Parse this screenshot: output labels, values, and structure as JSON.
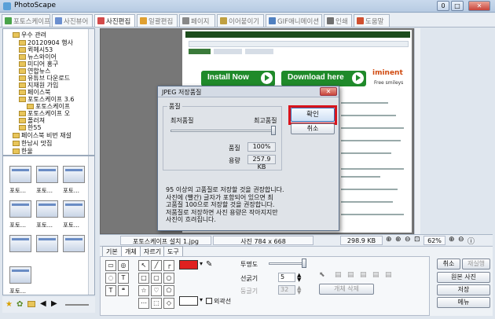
{
  "window": {
    "title": "PhotoScape"
  },
  "title_buttons": [
    "0",
    "□",
    "✕"
  ],
  "tabs": [
    {
      "label": "포토스케이프",
      "color": "#4aa44a"
    },
    {
      "label": "사진뷰어",
      "color": "#6b8fcf"
    },
    {
      "label": "사진편집",
      "color": "#d24a4a"
    },
    {
      "label": "일괄편집",
      "color": "#e0a030"
    },
    {
      "label": "페이지",
      "color": "#888888"
    },
    {
      "label": "이어붙이기",
      "color": "#c0a040"
    },
    {
      "label": "GIF애니메이션",
      "color": "#5080c0"
    },
    {
      "label": "인쇄",
      "color": "#707070"
    },
    {
      "label": "도움말",
      "color": "#d05030"
    }
  ],
  "tree": {
    "items": [
      "우수 관려",
      "20120904 행사",
      "퀵헤시53",
      "뉴스와이어",
      "미디어 홍구",
      "연합뉴스",
      "유튜브 다운로드",
      "지재원 가입",
      "페이스북",
      "포토스케이프 3.6",
      "포토스케이프",
      "포토스케이프 오",
      "폴러져",
      "한55",
      "페이스북 비번 재설",
      "한남시 맛집",
      "한울"
    ]
  },
  "thumbnails": {
    "captions": [
      "포토...",
      "포토...",
      "포토...",
      "포토...",
      "포토...",
      "포토...",
      "포토..."
    ]
  },
  "web": {
    "install_label": "Install Now",
    "download_label": "Download here",
    "brand": "iminent",
    "brand_sub": "Free smileys"
  },
  "status": {
    "filename": "포토스케이프 설치 1.jpg",
    "photo_size": "사진 784 x 668",
    "file_size": "298.9 KB",
    "zoom": "62%"
  },
  "editor": {
    "tabs": [
      "기본",
      "개체",
      "자르기",
      "도구"
    ],
    "fill_color": "#e02020",
    "opacity_label": "투명도",
    "line_width_label": "선굵기",
    "line_width_value": "5",
    "rounding_label": "둥글기",
    "rounding_value": "32",
    "outline_label": "외곽선",
    "delete_objects_label": "개체 삭제"
  },
  "right_buttons": {
    "undo": "취소",
    "redo": "재실행",
    "original": "원본 사진",
    "save": "저장",
    "menu": "메뉴"
  },
  "dialog": {
    "title": "JPEG 저장품질",
    "close": "✕",
    "quality_group": "품질",
    "min_label": "최저품질",
    "max_label": "최고품질",
    "quality_label": "품질",
    "quality_value": "100%",
    "size_label": "용량",
    "size_value": "257.9 KB",
    "ok": "확인",
    "cancel": "취소",
    "note": "95 이상의 고품질로 저장할 것을 권장합니다.\n사진에 (빨간) 글자가 포함되어 있으면 최\n고품질 100으로 저장할 것을 권장합니다.\n저품질로 저장하면 사진 용량은 작아지지만\n사진이 흐려집니다."
  }
}
